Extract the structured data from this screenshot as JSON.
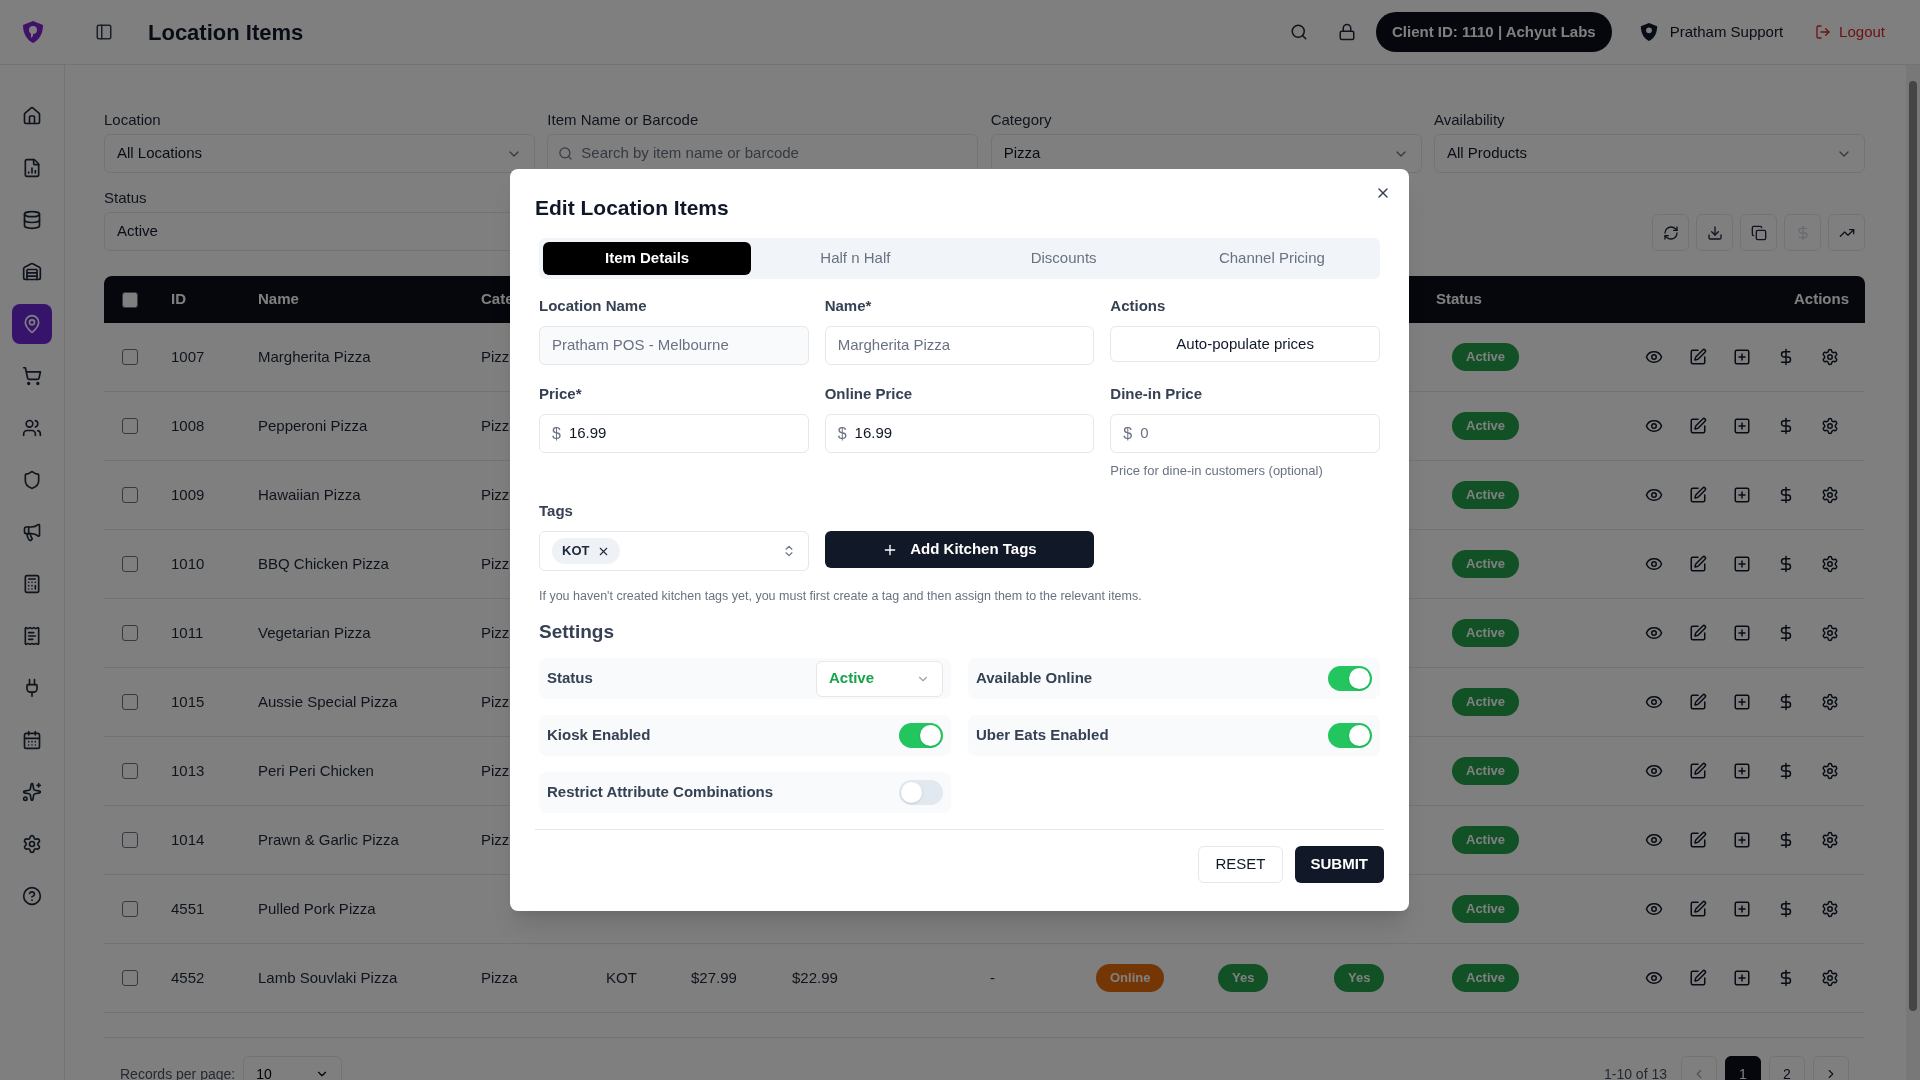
{
  "header": {
    "title": "Location Items",
    "client_badge": "Client ID: 1110 | Achyut Labs",
    "user": "Pratham Support",
    "logout": "Logout"
  },
  "sidebar": {
    "items": [
      {
        "kind": "home",
        "selected": false
      },
      {
        "kind": "report",
        "selected": false
      },
      {
        "kind": "database",
        "selected": false
      },
      {
        "kind": "warehouse",
        "selected": false
      },
      {
        "kind": "location",
        "selected": true
      },
      {
        "kind": "cart",
        "selected": false
      },
      {
        "kind": "users",
        "selected": false
      },
      {
        "kind": "shield",
        "selected": false
      },
      {
        "kind": "megaphone",
        "selected": false
      },
      {
        "kind": "calculator",
        "selected": false
      },
      {
        "kind": "receipt",
        "selected": false
      },
      {
        "kind": "plug",
        "selected": false
      },
      {
        "kind": "calendar",
        "selected": false
      },
      {
        "kind": "sparkles",
        "selected": false
      },
      {
        "kind": "settings",
        "selected": false
      },
      {
        "kind": "help",
        "selected": false
      }
    ]
  },
  "filters": [
    {
      "kind": "select",
      "label": "Location",
      "value": "All Locations"
    },
    {
      "kind": "search",
      "label": "Item Name or Barcode",
      "placeholder": "Search by item name or barcode"
    },
    {
      "kind": "select",
      "label": "Category",
      "value": "Pizza"
    },
    {
      "kind": "select",
      "label": "Availability",
      "value": "All Products"
    },
    {
      "kind": "plain",
      "label": "Status",
      "value": "Active"
    }
  ],
  "toolbar": [
    {
      "kind": "refresh",
      "disabled": false
    },
    {
      "kind": "download",
      "disabled": false
    },
    {
      "kind": "copy",
      "disabled": false
    },
    {
      "kind": "price",
      "disabled": true
    },
    {
      "kind": "trend",
      "disabled": false
    }
  ],
  "table": {
    "select_all": {
      "checked": false
    },
    "columns": [
      "ID",
      "Name",
      "Cate",
      "Status",
      "Actions"
    ],
    "rows": [
      {
        "selected": false,
        "id": "1007",
        "name": "Margherita Pizza",
        "category": "Pizz",
        "status": "Active"
      },
      {
        "selected": false,
        "id": "1008",
        "name": "Pepperoni Pizza",
        "category": "Pizz",
        "status": "Active"
      },
      {
        "selected": false,
        "id": "1009",
        "name": "Hawaiian Pizza",
        "category": "Pizz",
        "status": "Active"
      },
      {
        "selected": false,
        "id": "1010",
        "name": "BBQ Chicken Pizza",
        "category": "Pizz",
        "status": "Active"
      },
      {
        "selected": false,
        "id": "1011",
        "name": "Vegetarian Pizza",
        "category": "Pizz",
        "status": "Active"
      },
      {
        "selected": false,
        "id": "1015",
        "name": "Aussie Special Pizza",
        "category": "Pizz",
        "status": "Active"
      },
      {
        "selected": false,
        "id": "1013",
        "name": "Peri Peri Chicken",
        "category": "Pizz",
        "status": "Active"
      },
      {
        "selected": false,
        "id": "1014",
        "name": "Prawn & Garlic Pizza",
        "category": "Pizz",
        "status": "Active"
      },
      {
        "selected": false,
        "id": "4551",
        "name": "Pulled Pork Pizza",
        "status": "Active"
      },
      {
        "selected": false,
        "id": "4552",
        "name": "Lamb Souvlaki Pizza",
        "category": "Pizza",
        "tags": "KOT",
        "column_6": "$27.99",
        "column_7": "$22.99",
        "column_8": "-",
        "column_9": "Online",
        "column_10": "Yes",
        "column_11": "Yes",
        "status": "Active"
      }
    ]
  },
  "footer": {
    "records_label": "Records per page:",
    "page_size": "10",
    "range": "1-10 of 13",
    "pages": [
      {
        "label": "1",
        "selected": true
      },
      {
        "label": "2",
        "selected": false
      }
    ]
  },
  "modal": {
    "title": "Edit Location Items",
    "tabs": [
      {
        "label": "Item Details",
        "selected": true
      },
      {
        "label": "Half n Half",
        "selected": false
      },
      {
        "label": "Discounts",
        "selected": false
      },
      {
        "label": "Channel Pricing",
        "selected": false
      }
    ],
    "fields": [
      {
        "kind": "disabled",
        "label": "Location Name",
        "value": "Pratham POS - Melbourne"
      },
      {
        "kind": "text",
        "label": "Name*",
        "placeholder": "Margherita Pizza"
      },
      {
        "kind": "button",
        "label": "Actions",
        "value": "Auto-populate prices"
      },
      {
        "kind": "currency",
        "label": "Price*",
        "prefix": "$",
        "value": "16.99"
      },
      {
        "kind": "currency",
        "label": "Online Price",
        "prefix": "$",
        "value": "16.99"
      },
      {
        "kind": "currency",
        "label": "Dine-in Price",
        "prefix": "$",
        "placeholder": "0",
        "help": "Price for dine-in customers (optional)"
      }
    ],
    "tags": {
      "label": "Tags",
      "chips": [
        "KOT"
      ],
      "add_button": "Add Kitchen Tags",
      "hint": "If you haven't created kitchen tags yet, you must first create a tag and then assign them to the relevant items."
    },
    "settings": {
      "title": "Settings",
      "items": [
        {
          "kind": "select",
          "label": "Status",
          "value": "Active"
        },
        {
          "kind": "toggle",
          "label": "Available Online",
          "on": true
        },
        {
          "kind": "toggle",
          "label": "Kiosk Enabled",
          "on": true
        },
        {
          "kind": "toggle",
          "label": "Uber Eats Enabled",
          "on": true
        },
        {
          "kind": "toggle",
          "label": "Restrict Attribute Combinations",
          "on": false
        }
      ]
    },
    "buttons": {
      "reset": "RESET",
      "submit": "SUBMIT"
    }
  }
}
